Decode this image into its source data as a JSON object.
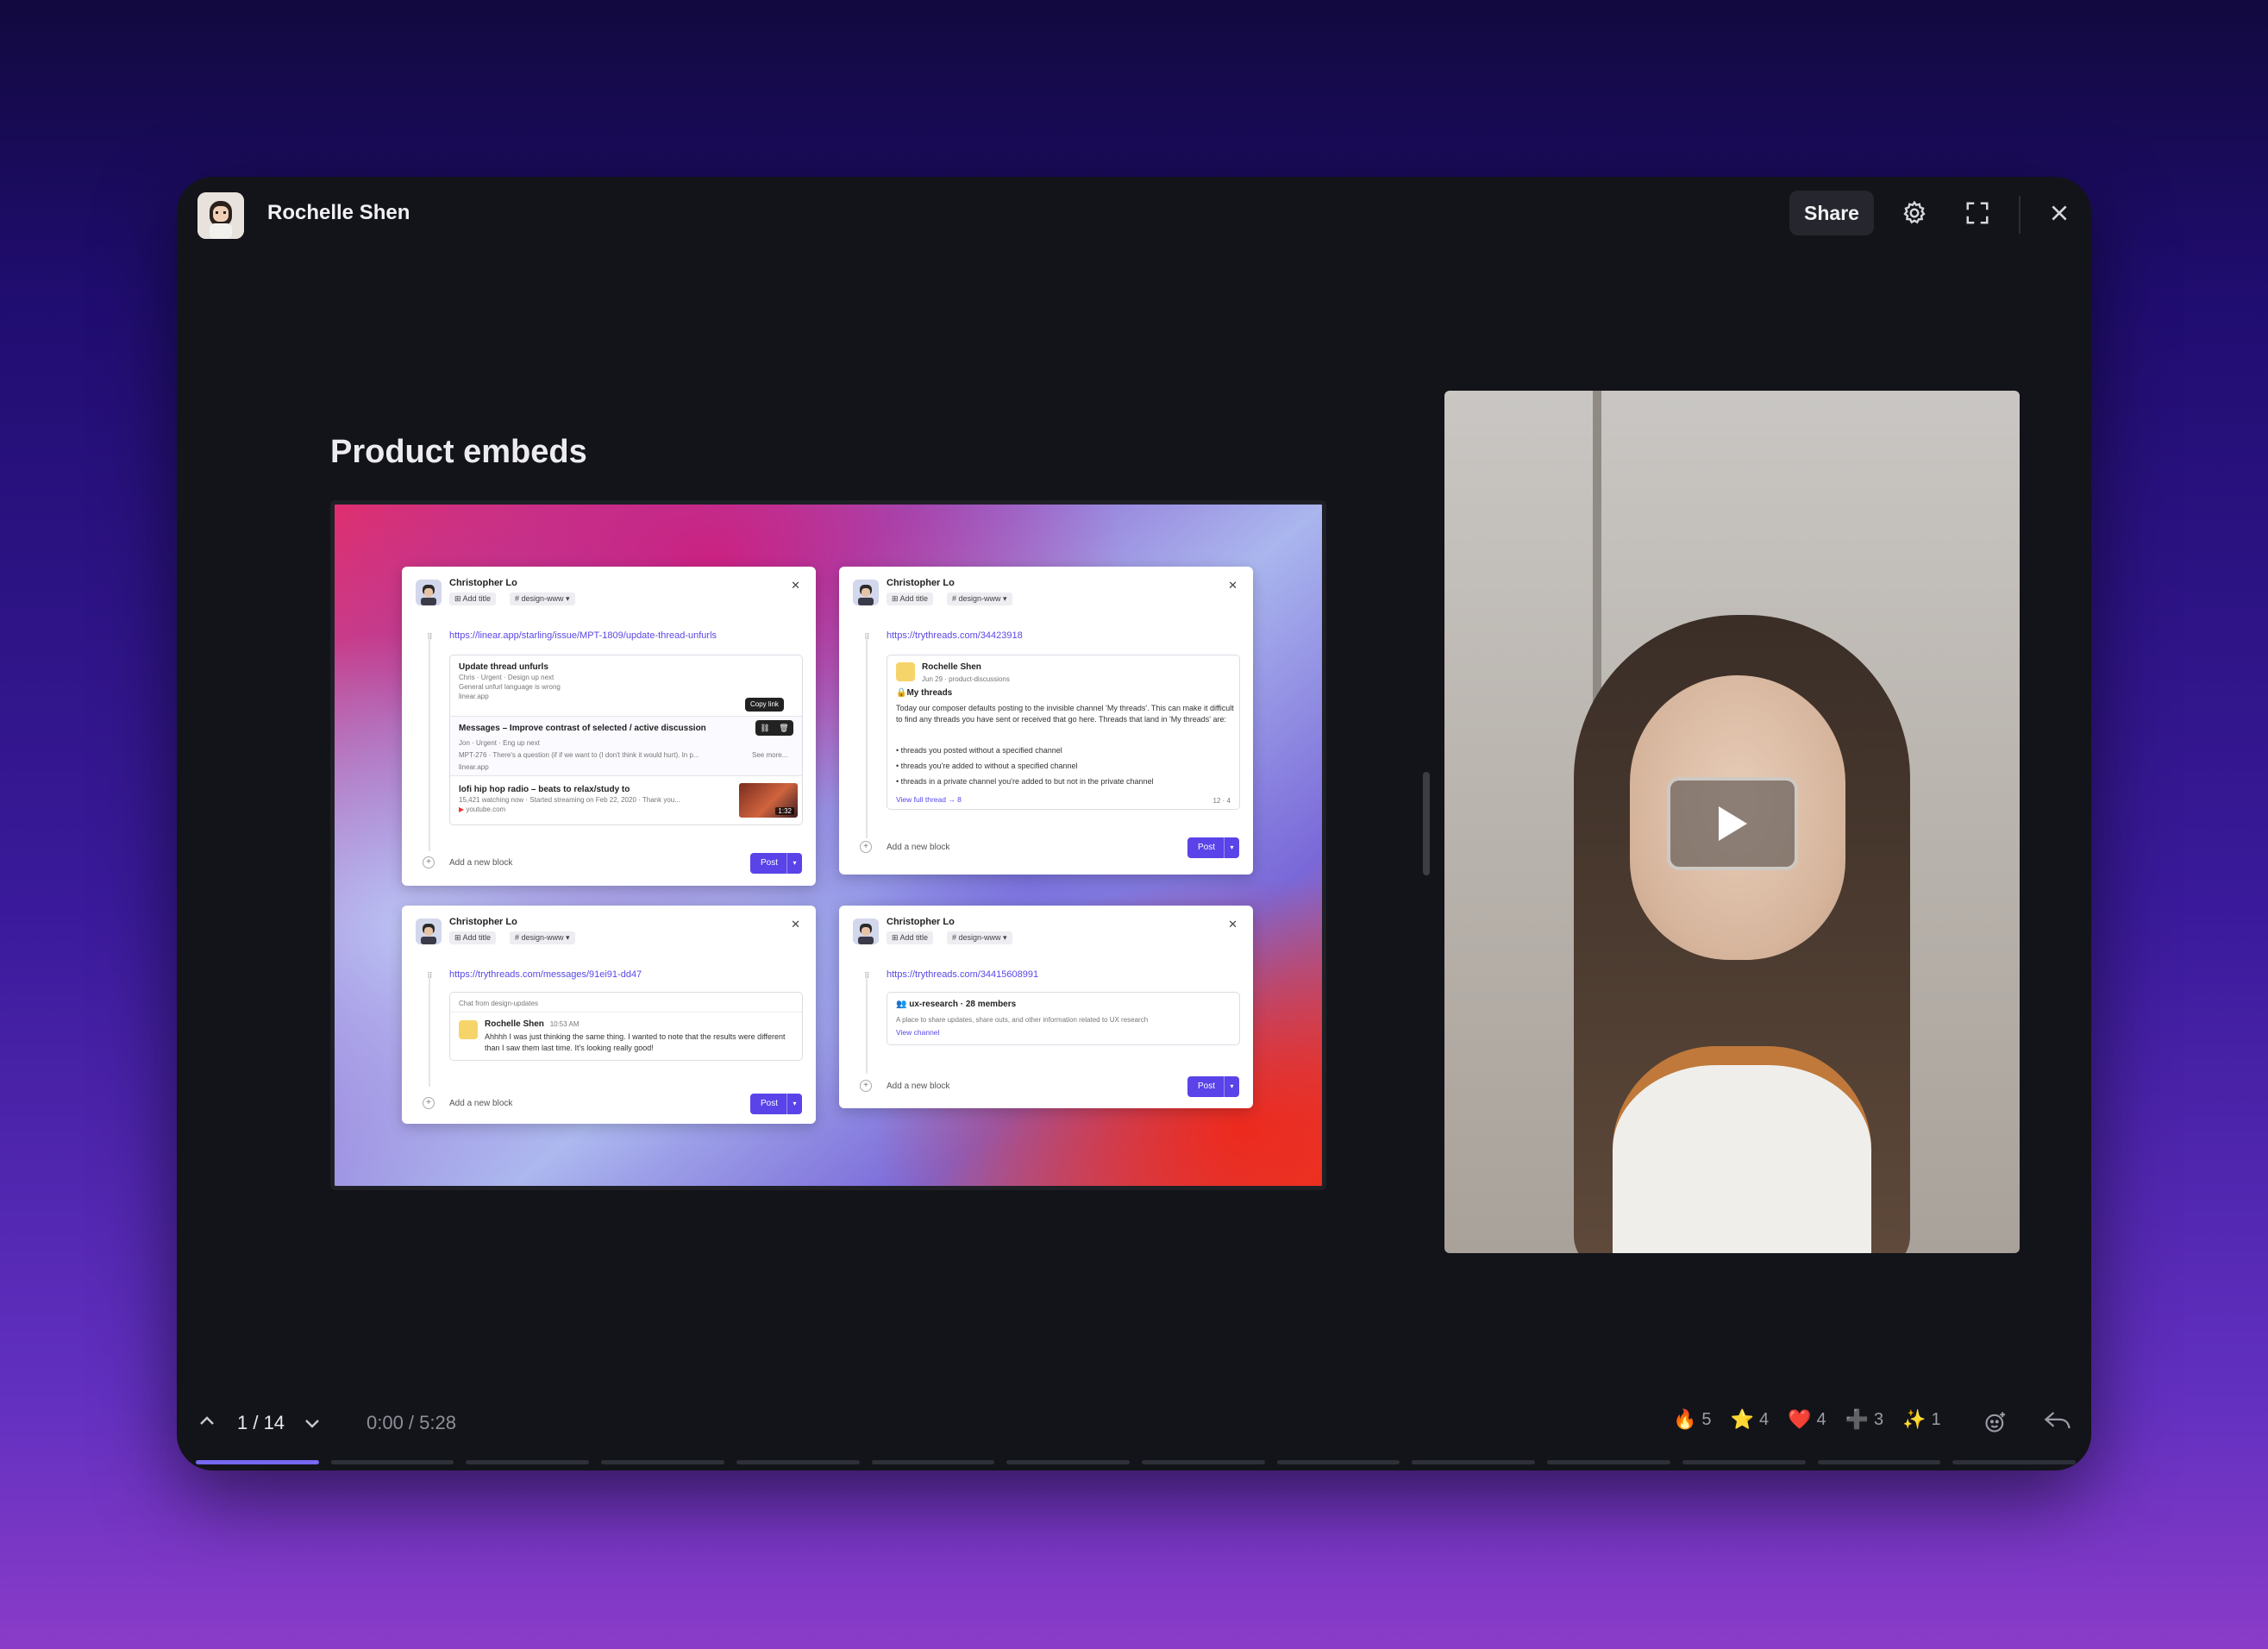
{
  "header": {
    "author": "Rochelle Shen",
    "share_label": "Share"
  },
  "slide": {
    "title": "Product embeds"
  },
  "cards": [
    {
      "author": "Christopher Lo",
      "add_title": "Add title",
      "channel": "design-www",
      "url": "https://linear.app/starling/issue/MPT-1809/update-thread-unfurls",
      "items": [
        {
          "title": "Update thread unfurls",
          "meta": "Chris · Urgent · Design up next",
          "desc": "General unfurl language is wrong",
          "source": "linear.app"
        },
        {
          "title": "Messages – Improve contrast of selected / active discussion",
          "meta": "Jon · Urgent · Eng up next",
          "desc": "MPT-276 · There's a question (if if we want to (I don't think it would hurt). In p...",
          "more": "See more...",
          "source": "linear.app",
          "tooltip": "Copy link"
        },
        {
          "title": "lofi hip hop radio – beats to relax/study to",
          "meta": "15,421 watching now · Started streaming on Feb 22, 2020 · Thank you...",
          "source": "youtube.com",
          "duration": "1:32"
        }
      ],
      "add_block": "Add a new block",
      "post": "Post"
    },
    {
      "author": "Christopher Lo",
      "add_title": "Add title",
      "channel": "design-www",
      "url": "https://trythreads.com/34423918",
      "embed_author": "Rochelle Shen",
      "embed_meta": "Jun 29 · product-discussions",
      "embed_heading": "🔒My threads",
      "embed_body": "Today our composer defaults posting to the invisible channel 'My threads'. This can make it difficult to find any threads you have sent or received that go here. Threads that land in 'My threads' are:",
      "bullets": [
        "threads you posted without a specified channel",
        "threads you're added to without a specified channel",
        "threads in a private channel you're added to but not in the private channel"
      ],
      "view_thread": "View full thread → 8",
      "embed_stats": "12 · 4",
      "add_block": "Add a new block",
      "post": "Post"
    },
    {
      "author": "Christopher Lo",
      "add_title": "Add title",
      "channel": "design-www",
      "url": "https://trythreads.com/messages/91ei91-dd47",
      "chat_from": "Chat from design-updates",
      "msg_author": "Rochelle Shen",
      "msg_time": "10:53 AM",
      "msg_text": "Ahhhh I was just thinking the same thing. I wanted to note that the results were different than I saw them last time. It's looking really good!",
      "add_block": "Add a new block",
      "post": "Post"
    },
    {
      "author": "Christopher Lo",
      "add_title": "Add title",
      "channel": "design-www",
      "url": "https://trythreads.com/34415608991",
      "channel_name": "ux-research · 28 members",
      "channel_desc": "A place to share updates, share outs, and other information related to UX research",
      "view_channel": "View channel",
      "add_block": "Add a new block",
      "post": "Post"
    }
  ],
  "footer": {
    "page": "1 / 14",
    "time": "0:00 / 5:28",
    "reactions": [
      {
        "icon": "fire-icon",
        "emoji": "🔥",
        "count": "5"
      },
      {
        "icon": "star-icon",
        "emoji": "⭐",
        "count": "4"
      },
      {
        "icon": "heart-icon",
        "emoji": "❤️",
        "count": "4"
      },
      {
        "icon": "plus-icon",
        "emoji": "➕",
        "count": "3"
      },
      {
        "icon": "sparkles-icon",
        "emoji": "✨",
        "count": "1"
      }
    ],
    "progress": {
      "total_segments": 14,
      "current": 1
    }
  }
}
